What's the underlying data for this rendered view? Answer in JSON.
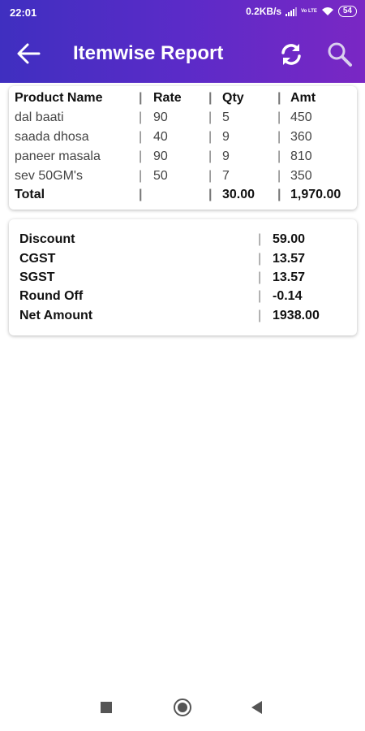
{
  "status": {
    "time": "22:01",
    "speed": "0.2KB/s",
    "net": "Vo LTE",
    "battery": "54"
  },
  "appbar": {
    "title": "Itemwise Report",
    "icons": [
      "back-arrow-icon",
      "refresh-icon",
      "search-icon"
    ]
  },
  "table": {
    "headers": [
      "Product Name",
      "Rate",
      "Qty",
      "Amt"
    ],
    "rows": [
      [
        "dal baati",
        "90",
        "5",
        "450"
      ],
      [
        "saada dhosa",
        "40",
        "9",
        "360"
      ],
      [
        "paneer masala",
        "90",
        "9",
        "810"
      ],
      [
        "sev 50GM's",
        "50",
        "7",
        "350"
      ]
    ],
    "separator": "|",
    "total": {
      "label": "Total",
      "rate": "",
      "qty": "30.00",
      "amt": "1,970.00"
    }
  },
  "summary": [
    {
      "label": "Discount",
      "value": "59.00"
    },
    {
      "label": "CGST",
      "value": "13.57"
    },
    {
      "label": "SGST",
      "value": "13.57"
    },
    {
      "label": "Round Off",
      "value": "-0.14"
    },
    {
      "label": "Net Amount",
      "value": "1938.00"
    }
  ],
  "colors": {
    "appbar_start": "#3f2fc0",
    "appbar_end": "#7a27c4",
    "nav_icon": "#555555"
  }
}
